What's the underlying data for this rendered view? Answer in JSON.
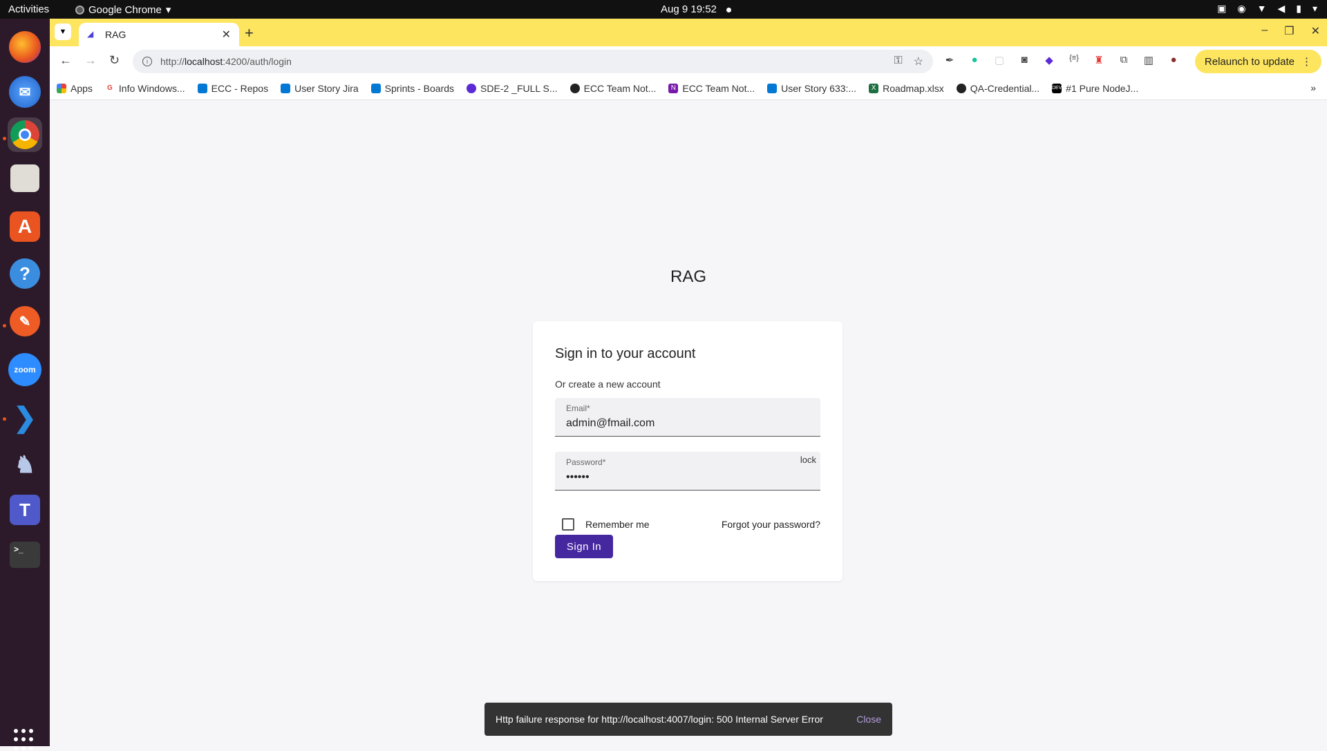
{
  "topbar": {
    "activities": "Activities",
    "app_name": "Google Chrome",
    "clock": "Aug 9  19:52"
  },
  "dock": {
    "items": [
      "firefox-icon",
      "thunderbird-icon",
      "chrome-icon",
      "files-icon",
      "app-center-icon",
      "help-icon",
      "postman-icon",
      "zoom-icon",
      "vscode-icon",
      "pgadmin-icon",
      "teams-icon",
      "terminal-icon"
    ],
    "zoom_label": "zoom"
  },
  "browser": {
    "tab_title": "RAG",
    "url_scheme": "http://",
    "url_host": "localhost",
    "url_path": ":4200/auth/login",
    "relaunch_label": "Relaunch to update",
    "bookmarks": [
      "Apps",
      "Info Windows...",
      "ECC - Repos",
      "User Story Jira",
      "Sprints - Boards",
      "SDE-2 _FULL S...",
      "ECC Team Not...",
      "ECC Team Not...",
      "User Story 633:...",
      "Roadmap.xlsx",
      "QA-Credential...",
      "#1 Pure NodeJ..."
    ]
  },
  "page": {
    "app_title": "RAG",
    "card_title": "Sign in to your account",
    "card_subtitle": "Or create a new account",
    "email_label": "Email*",
    "email_value": "admin@fmail.com",
    "password_label": "Password*",
    "password_value": "••••••",
    "password_suffix": "lock",
    "remember_label": "Remember me",
    "forgot_label": "Forgot your password?",
    "signin_label": "Sign In"
  },
  "snackbar": {
    "message": "Http failure response for http://localhost:4007/login: 500 Internal Server Error",
    "close_label": "Close"
  },
  "colors": {
    "tabstrip": "#fde55f",
    "primary_button": "#4527a0",
    "snackbar_bg": "#333333",
    "snackbar_action": "#b39ddb"
  }
}
